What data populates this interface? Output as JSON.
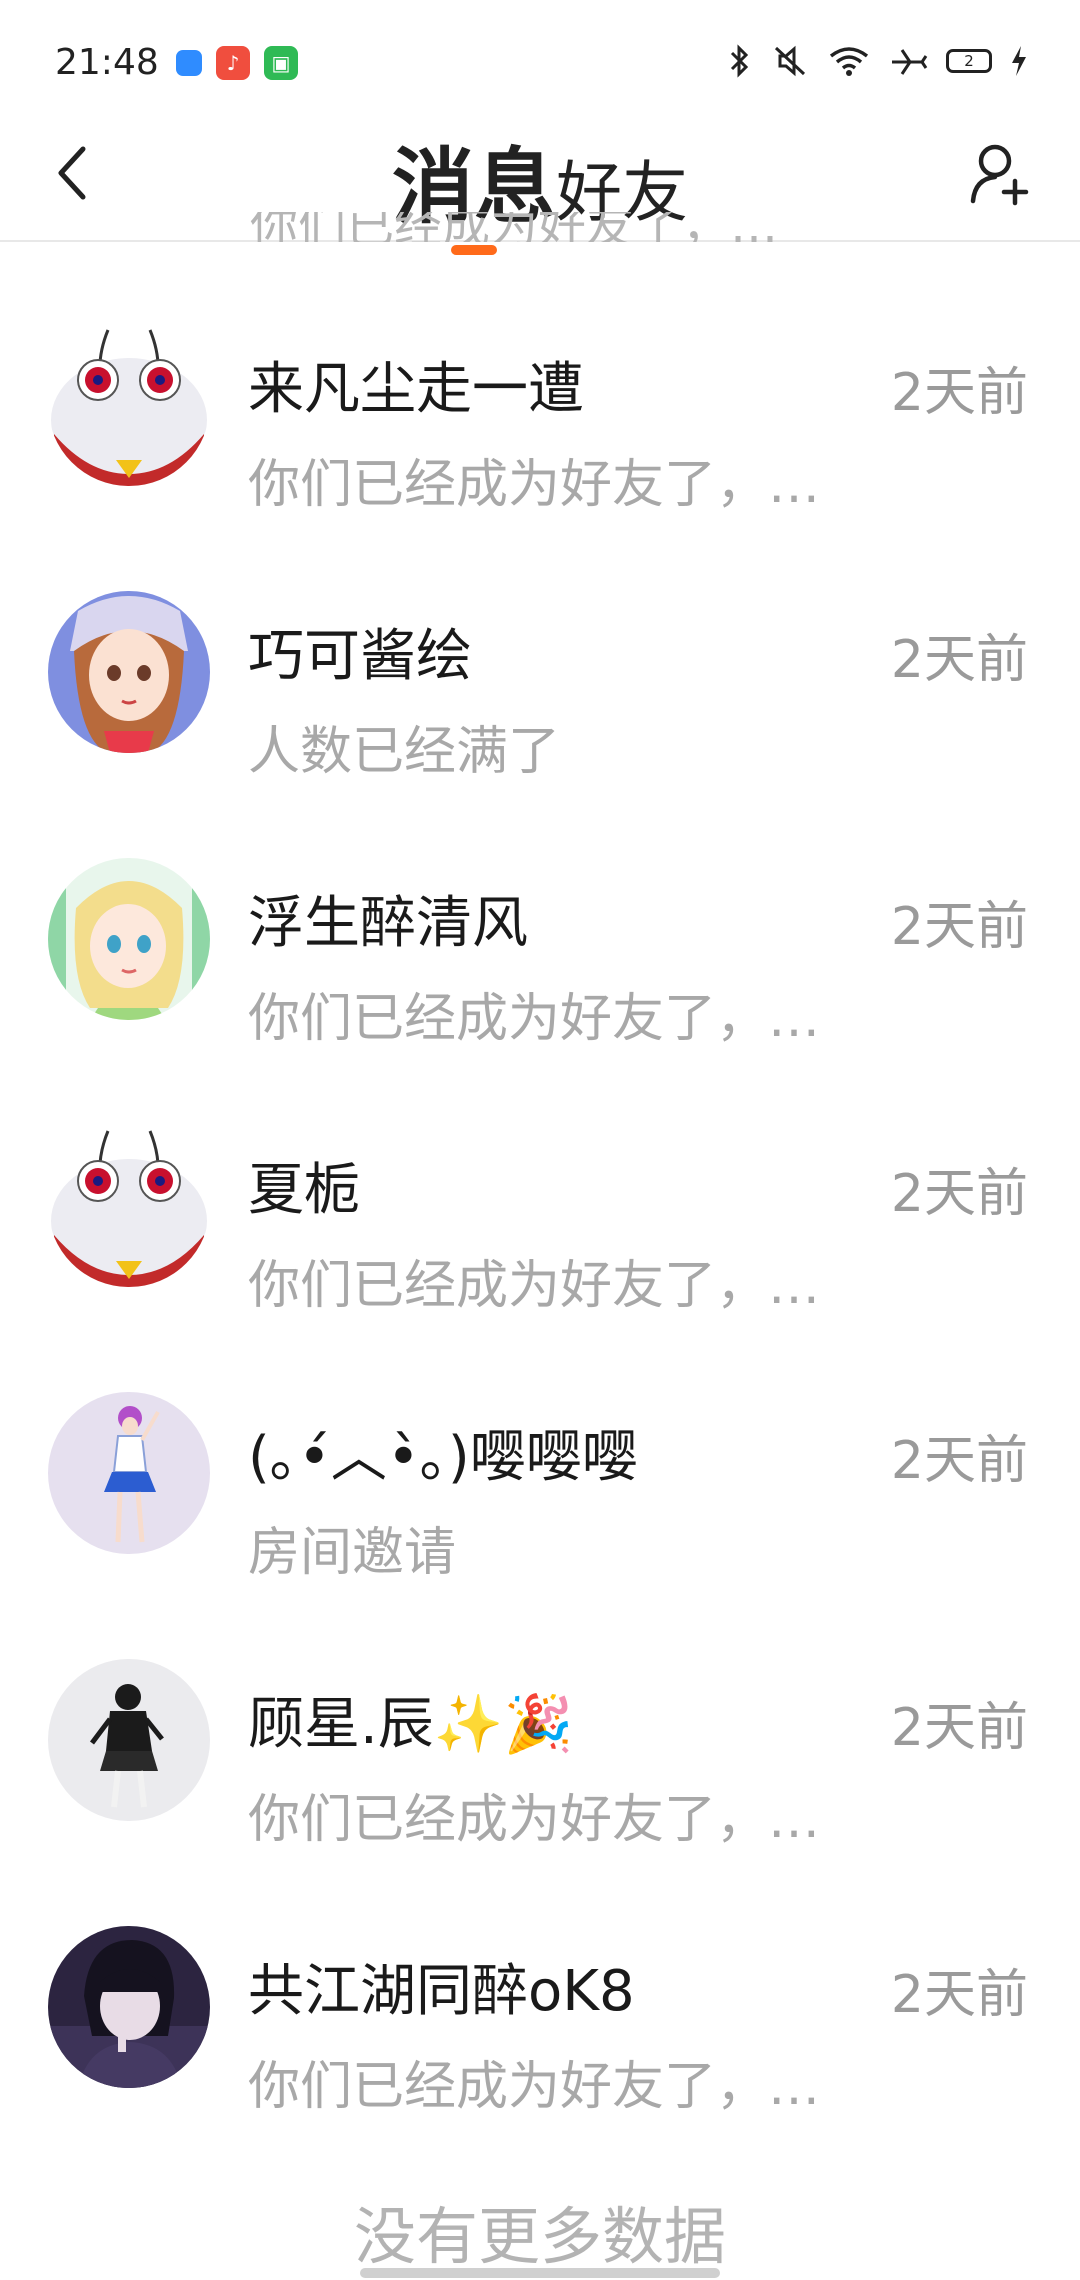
{
  "status_bar": {
    "time": "21:48",
    "battery": "2",
    "icons": [
      "app-blue-icon",
      "music-app-icon",
      "store-app-icon",
      "bluetooth-icon",
      "mute-icon",
      "wifi-icon",
      "airplane-icon",
      "battery-icon",
      "charging-icon"
    ]
  },
  "header": {
    "tab_active": "消息",
    "tab_inactive": "好友",
    "accent_color": "#ff6a1a"
  },
  "partial_preview": "你们已经成为好友了，…",
  "conversations": [
    {
      "name": "来凡尘走一遭",
      "preview": "你们已经成为好友了，…",
      "time": "2天前"
    },
    {
      "name": "巧可酱绘",
      "preview": "人数已经满了",
      "time": "2天前"
    },
    {
      "name": "浮生醉清风",
      "preview": "你们已经成为好友了，…",
      "time": "2天前"
    },
    {
      "name": "夏栀",
      "preview": "你们已经成为好友了，…",
      "time": "2天前"
    },
    {
      "name": "(｡•́︿•̀｡)嘤嘤嘤",
      "preview": "房间邀请",
      "time": "2天前"
    },
    {
      "name": "顾星.辰✨🎉",
      "preview": "你们已经成为好友了，…",
      "time": "2天前"
    },
    {
      "name": "共江湖同醉oK8",
      "preview": "你们已经成为好友了，…",
      "time": "2天前"
    }
  ],
  "footer": {
    "no_more": "没有更多数据"
  }
}
